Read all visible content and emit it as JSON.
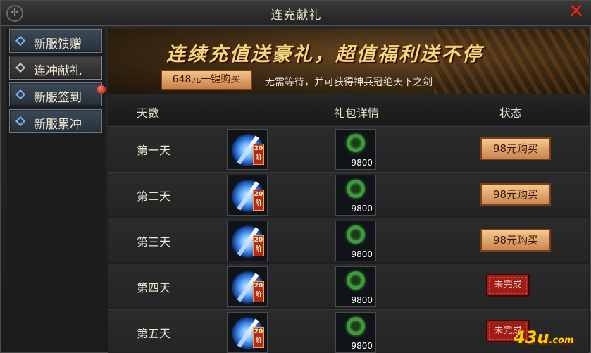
{
  "window": {
    "title": "连充献礼",
    "close_icon": "close-icon"
  },
  "sidebar": {
    "items": [
      {
        "label": "新服馈赠",
        "active": false,
        "dot": false
      },
      {
        "label": "连冲献礼",
        "active": true,
        "dot": false
      },
      {
        "label": "新服签到",
        "active": false,
        "dot": true
      },
      {
        "label": "新服累冲",
        "active": false,
        "dot": false
      }
    ]
  },
  "banner": {
    "headline": "连续充值送豪礼，超值福利送不停",
    "buy_all_label": "648元一键购买",
    "subtitle": "无需等待，并可获得神兵冠绝天下之剑"
  },
  "table": {
    "headers": {
      "day": "天数",
      "gift": "礼包详情",
      "status": "状态"
    },
    "rows": [
      {
        "day": "第一天",
        "weapon_tier": "20阶",
        "orb_count": "9800",
        "status": "98元购买",
        "status_type": "buy"
      },
      {
        "day": "第二天",
        "weapon_tier": "20阶",
        "orb_count": "9800",
        "status": "98元购买",
        "status_type": "buy"
      },
      {
        "day": "第三天",
        "weapon_tier": "20阶",
        "orb_count": "9800",
        "status": "98元购买",
        "status_type": "buy"
      },
      {
        "day": "第四天",
        "weapon_tier": "20阶",
        "orb_count": "9800",
        "status": "未完成",
        "status_type": "undone"
      },
      {
        "day": "第五天",
        "weapon_tier": "20阶",
        "orb_count": "9800",
        "status": "未完成",
        "status_type": "undone"
      }
    ]
  },
  "watermark": {
    "text": "43u",
    "suffix": ".com"
  },
  "colors": {
    "accent_gold": "#f3d884",
    "buy_button": "#e0a46a",
    "undone_red": "#9e1d16",
    "close_red": "#e02a18"
  }
}
